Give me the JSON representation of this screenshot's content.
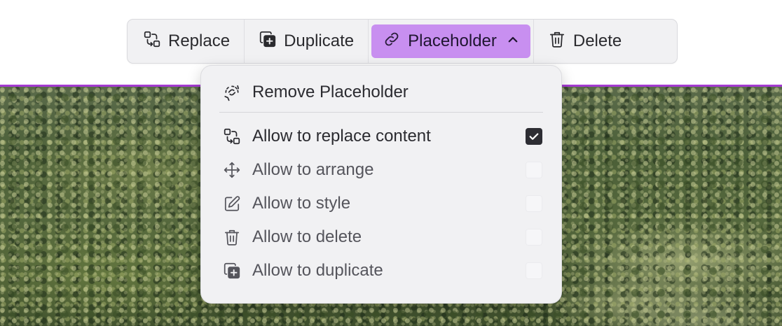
{
  "toolbar": {
    "buttons": [
      {
        "label": "Replace",
        "icon": "replace-icon"
      },
      {
        "label": "Duplicate",
        "icon": "duplicate-icon"
      },
      {
        "label": "Placeholder",
        "icon": "link-icon",
        "active": true,
        "trailing_icon": "chevron-up-icon"
      },
      {
        "label": "Delete",
        "icon": "trash-icon"
      }
    ]
  },
  "menu": {
    "remove_label": "Remove Placeholder",
    "options": [
      {
        "label": "Allow to replace content",
        "icon": "replace-icon",
        "checked": true
      },
      {
        "label": "Allow to arrange",
        "icon": "move-icon",
        "checked": false
      },
      {
        "label": "Allow to style",
        "icon": "edit-icon",
        "checked": false
      },
      {
        "label": "Allow to delete",
        "icon": "trash-icon",
        "checked": false
      },
      {
        "label": "Allow to duplicate",
        "icon": "duplicate-icon",
        "checked": false
      }
    ]
  },
  "colors": {
    "active_button": "#c88ff0",
    "selection_border": "#a43ad1",
    "checkbox_checked": "#2d2d33"
  }
}
